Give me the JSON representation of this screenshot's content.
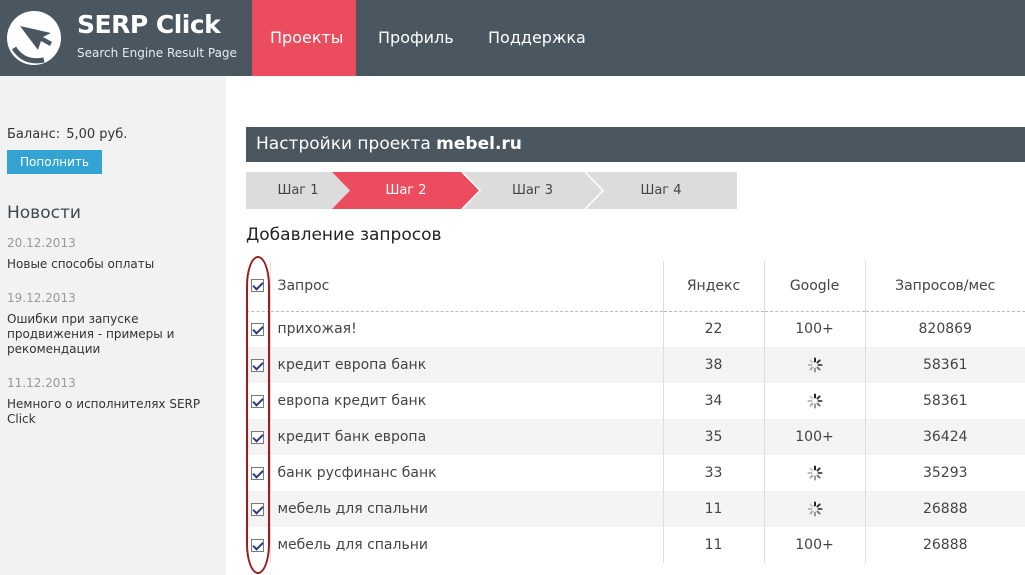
{
  "brand": {
    "title": "SERP Click",
    "subtitle": "Search Engine Result Page"
  },
  "nav": {
    "items": [
      "Проекты",
      "Профиль",
      "Поддержка"
    ],
    "active_color": "#ec4d5e"
  },
  "sidebar": {
    "balance_label": "Баланс:",
    "balance_value": "5,00 руб.",
    "topup_label": "Пополнить",
    "news_title": "Новости",
    "news": [
      {
        "date": "20.12.2013",
        "text": "Новые способы оплаты"
      },
      {
        "date": "19.12.2013",
        "text": "Ошибки при запуске продвижения - примеры и рекомендации"
      },
      {
        "date": "11.12.2013",
        "text": "Немного о исполнителях SERP Click"
      }
    ]
  },
  "project": {
    "label": "Настройки проекта",
    "name": "mebel.ru"
  },
  "steps": {
    "items": [
      "Шаг 1",
      "Шаг 2",
      "Шаг 3",
      "Шаг 4"
    ],
    "active_index": 1
  },
  "section_title": "Добавление запросов",
  "table": {
    "headers": {
      "query": "Запрос",
      "yandex": "Яндекс",
      "google": "Google",
      "monthly": "Запросов/мес"
    },
    "rows": [
      {
        "query": "прихожая!",
        "yandex": "22",
        "google": "100+",
        "monthly": "820869"
      },
      {
        "query": "кредит европа банк",
        "yandex": "38",
        "google": "",
        "monthly": "58361"
      },
      {
        "query": "европа кредит банк",
        "yandex": "34",
        "google": "",
        "monthly": "58361"
      },
      {
        "query": "кредит банк европа",
        "yandex": "35",
        "google": "100+",
        "monthly": "36424"
      },
      {
        "query": "банк русфинанс банк",
        "yandex": "33",
        "google": "",
        "monthly": "35293"
      },
      {
        "query": "мебель для спальни",
        "yandex": "11",
        "google": "",
        "monthly": "26888"
      },
      {
        "query": "мебель для спальни",
        "yandex": "11",
        "google": "100+",
        "monthly": "26888"
      }
    ],
    "google_loading_icon": "loading-spinner-icon"
  }
}
